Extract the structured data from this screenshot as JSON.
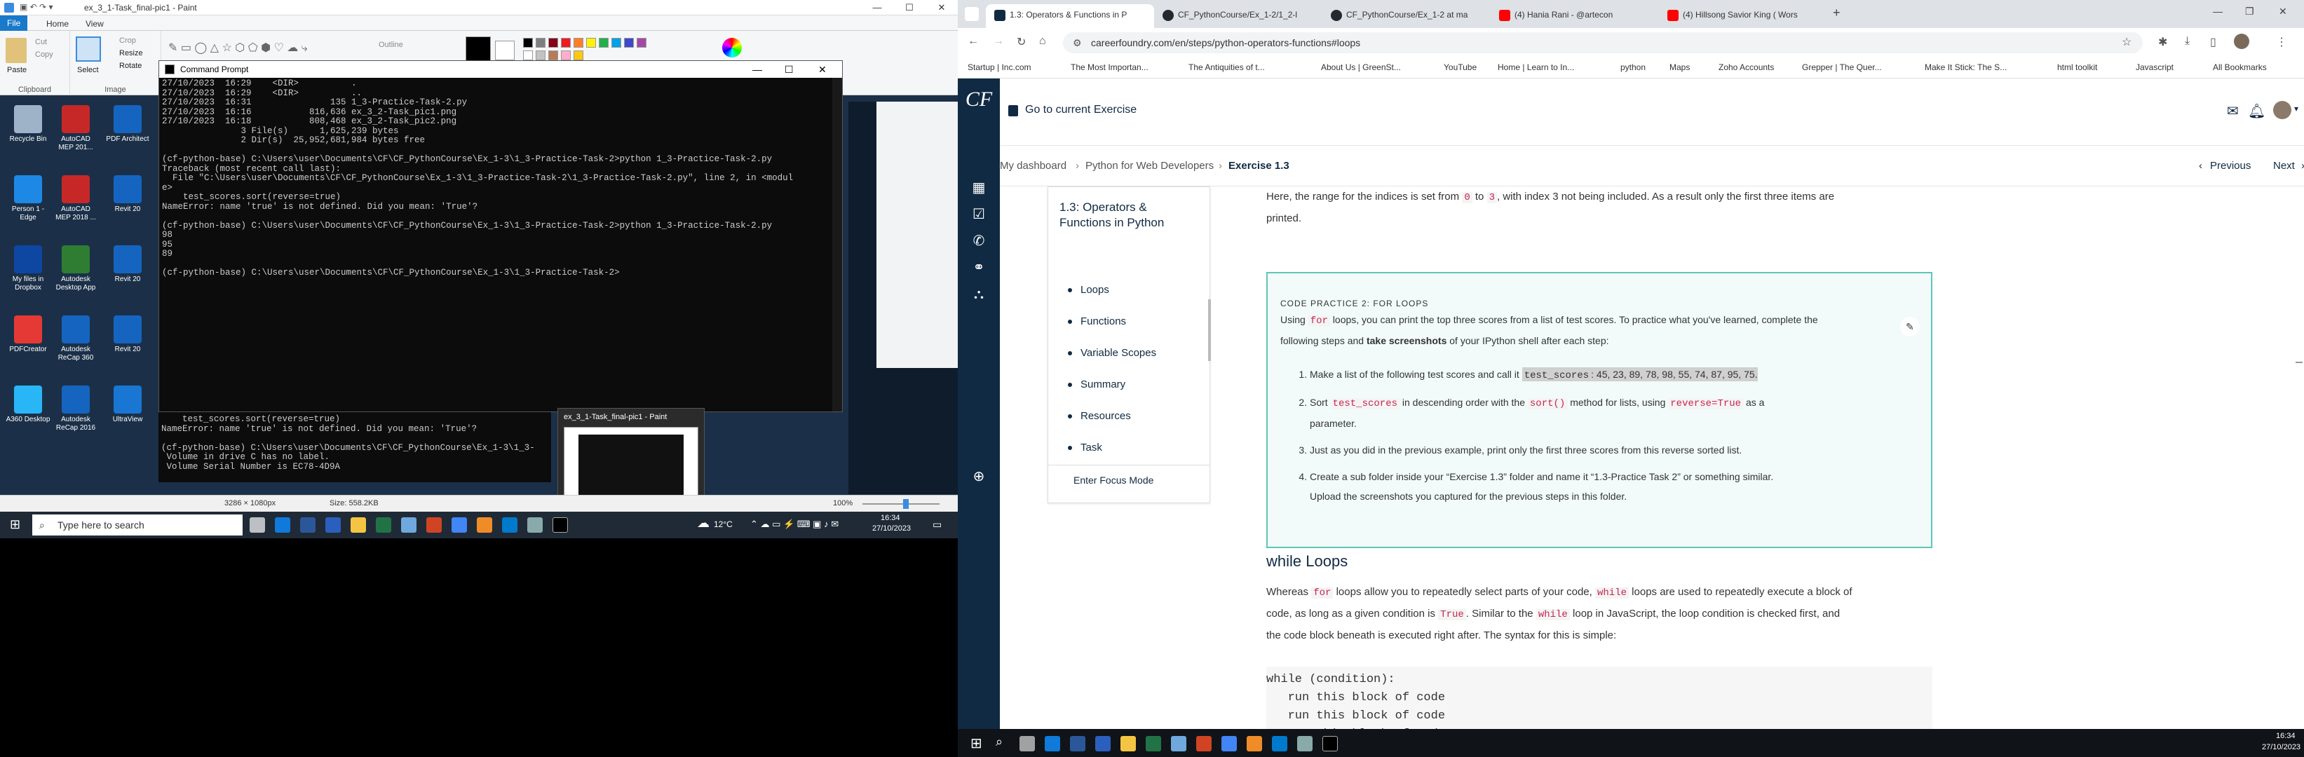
{
  "paint": {
    "title": "ex_3_1-Task_final-pic1 - Paint",
    "tabs": [
      "File",
      "Home",
      "View"
    ],
    "clipboard": {
      "paste": "Paste",
      "cut": "Cut",
      "copy": "Copy",
      "label": "Clipboard"
    },
    "image": {
      "select": "Select",
      "crop": "Crop",
      "resize": "Resize",
      "rotate": "Rotate",
      "label": "Image"
    },
    "outline": "Outline",
    "status": {
      "dimensions": "3286 × 1080px",
      "size": "Size: 558.2KB",
      "zoom": "100%"
    }
  },
  "desktop_icons": [
    {
      "label": "Recycle Bin",
      "color": "#9fb3c8"
    },
    {
      "label": "AutoCAD MEP 201...",
      "color": "#c62828"
    },
    {
      "label": "PDF Architect",
      "color": "#1565c0"
    },
    {
      "label": "Person 1 - Edge",
      "color": "#1e88e5"
    },
    {
      "label": "AutoCAD MEP 2018 ...",
      "color": "#c62828"
    },
    {
      "label": "Revit 20",
      "color": "#1565c0"
    },
    {
      "label": "My files in Dropbox",
      "color": "#0d47a1"
    },
    {
      "label": "Autodesk Desktop App",
      "color": "#2e7d32"
    },
    {
      "label": "Revit 20",
      "color": "#1565c0"
    },
    {
      "label": "PDFCreator",
      "color": "#e53935"
    },
    {
      "label": "Autodesk ReCap 360",
      "color": "#1565c0"
    },
    {
      "label": "Revit 20",
      "color": "#1565c0"
    },
    {
      "label": "A360 Desktop",
      "color": "#29b6f6"
    },
    {
      "label": "Autodesk ReCap 2016",
      "color": "#1565c0"
    },
    {
      "label": "UltraView",
      "color": "#1976d2"
    }
  ],
  "cmd": {
    "title": "Command Prompt",
    "lines": [
      "27/10/2023  16:29    <DIR>          .",
      "27/10/2023  16:29    <DIR>          ..",
      "27/10/2023  16:31               135 1_3-Practice-Task-2.py",
      "27/10/2023  16:16           816,636 ex_3_2-Task_pic1.png",
      "27/10/2023  16:18           808,468 ex_3_2-Task_pic2.png",
      "               3 File(s)      1,625,239 bytes",
      "               2 Dir(s)  25,952,681,984 bytes free",
      "",
      "(cf-python-base) C:\\Users\\user\\Documents\\CF\\CF_PythonCourse\\Ex_1-3\\1_3-Practice-Task-2>python 1_3-Practice-Task-2.py",
      "Traceback (most recent call last):",
      "  File \"C:\\Users\\user\\Documents\\CF\\CF_PythonCourse\\Ex_1-3\\1_3-Practice-Task-2\\1_3-Practice-Task-2.py\", line 2, in <modul",
      "e>",
      "    test_scores.sort(reverse=true)",
      "NameError: name 'true' is not defined. Did you mean: 'True'?",
      "",
      "(cf-python-base) C:\\Users\\user\\Documents\\CF\\CF_PythonCourse\\Ex_1-3\\1_3-Practice-Task-2>python 1_3-Practice-Task-2.py",
      "98",
      "95",
      "89",
      "",
      "(cf-python-base) C:\\Users\\user\\Documents\\CF\\CF_PythonCourse\\Ex_1-3\\1_3-Practice-Task-2>"
    ],
    "back_lines": [
      "    test_scores.sort(reverse=true)",
      "NameError: name 'true' is not defined. Did you mean: 'True'?",
      "",
      "(cf-python-base) C:\\Users\\user\\Documents\\CF\\CF_PythonCourse\\Ex_1-3\\1_3-",
      " Volume in drive C has no label.",
      " Volume Serial Number is EC78-4D9A"
    ]
  },
  "thumb_title": "ex_3_1-Task_final-pic1 - Paint",
  "left_taskbar": {
    "search": "Type here to search",
    "weather": "12°C",
    "time": "16:34",
    "date": "27/10/2023"
  },
  "browser": {
    "tabs": [
      {
        "label": "1.3: Operators & Functions in P",
        "color": "#112a43"
      },
      {
        "label": "CF_PythonCourse/Ex_1-2/1_2-l",
        "color": "#24292f"
      },
      {
        "label": "CF_PythonCourse/Ex_1-2 at ma",
        "color": "#24292f"
      },
      {
        "label": "(4) Hania Rani - @artecon",
        "color": "#ff0000"
      },
      {
        "label": "(4) Hillsong Savior King ( Wors",
        "color": "#ff0000"
      }
    ],
    "url": "careerfoundry.com/en/steps/python-operators-functions#loops",
    "bookmarks": [
      "Startup | Inc.com",
      "The Most Importan...",
      "The Antiquities of t...",
      "About Us | GreenSt...",
      "YouTube",
      "Home | Learn to In...",
      "python",
      "Maps",
      "Zoho Accounts",
      "Grepper | The Quer...",
      "Make It Stick: The S...",
      "html toolkit",
      "Javascript",
      "All Bookmarks"
    ]
  },
  "cf": {
    "logo": "CF",
    "go_current": "Go to current Exercise",
    "crumbs": [
      "My dashboard",
      "Python for Web Developers",
      "Exercise 1.3"
    ],
    "prev": "Previous",
    "next": "Next",
    "toc_title": "1.3: Operators & Functions in Python",
    "toc_items": [
      "Loops",
      "Functions",
      "Variable Scopes",
      "Summary",
      "Resources",
      "Task"
    ],
    "focus_mode": "Enter Focus Mode",
    "intro_a": "Here, the range for the indices is set from",
    "intro_0": "0",
    "intro_to": "to",
    "intro_3": "3",
    "intro_b": ", with index 3 not being included. As a result only the first three items are",
    "intro_c": "printed.",
    "practice_head": "CODE PRACTICE 2: FOR LOOPS",
    "practice_p1a": "Using",
    "practice_for": "for",
    "practice_p1b": "loops, you can print the top three scores from a list of test scores. To practice what you've learned, complete the",
    "practice_p2a": "following steps and",
    "practice_p2b": "take screenshots",
    "practice_p2c": "of your IPython shell after each step:",
    "step1a": "Make a list of the following test scores and call it",
    "step1code": "test_scores",
    "step1b": ": 45, 23, 89, 78, 98, 55, 74, 87, 95, 75.",
    "step2a": "Sort",
    "step2code": "test_scores",
    "step2b": "in descending order with the",
    "step2c": "sort()",
    "step2d": "method for lists, using",
    "step2e": "reverse=True",
    "step2f": "as a",
    "step2g": "parameter.",
    "step3": "Just as you did in the previous example, print only the first three scores from this reverse sorted list.",
    "step4a": "Create a sub folder inside your “Exercise 1.3” folder and name it “1.3-Practice Task 2” or something similar.",
    "step4b": "Upload the screenshots you captured for the previous steps in this folder.",
    "while_title": "while Loops",
    "while_p1a": "Whereas",
    "while_for": "for",
    "while_p1b": "loops allow you to repeatedly select parts of your code,",
    "while_while": "while",
    "while_p1c": "loops are used to repeatedly execute a block of",
    "while_p2a": "code, as long as a given condition is",
    "while_true": "True",
    "while_p2b": ". Similar to the",
    "while_while2": "while",
    "while_p2c": "loop in JavaScript, the loop condition is checked first, and",
    "while_p3": "the code block beneath is executed right after. The syntax for this is simple:",
    "code_lines": [
      "while (condition):",
      "   run this block of code",
      "   run this block of code",
      "   run this block of code"
    ]
  },
  "right_taskbar": {
    "time": "16:34",
    "date": "27/10/2023"
  }
}
